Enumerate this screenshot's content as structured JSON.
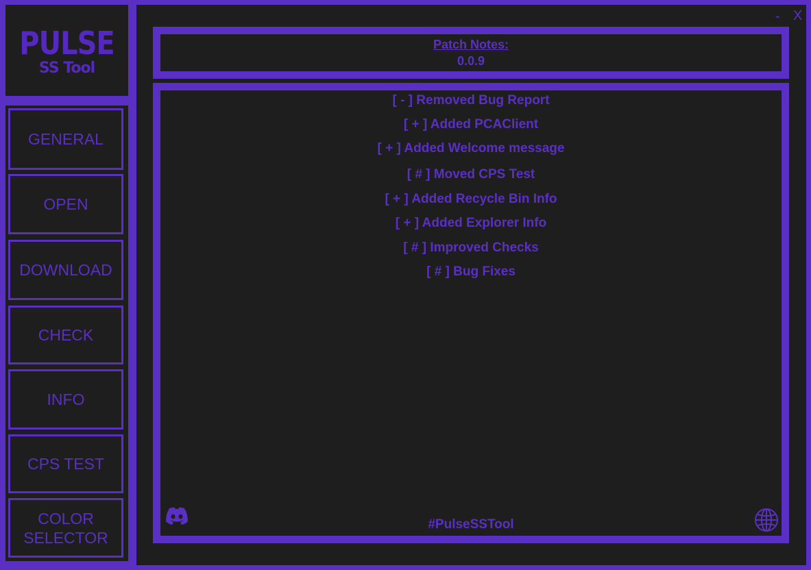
{
  "logo": {
    "title": "PULSE",
    "subtitle": "SS Tool"
  },
  "window_controls": {
    "minimize": "-",
    "close": "X"
  },
  "nav": [
    {
      "label": "GENERAL"
    },
    {
      "label": "OPEN"
    },
    {
      "label": "DOWNLOAD"
    },
    {
      "label": "CHECK"
    },
    {
      "label": "INFO"
    },
    {
      "label": "CPS TEST"
    },
    {
      "label": "COLOR\nSELECTOR"
    }
  ],
  "patch_notes": {
    "title": "Patch Notes:",
    "version": "0.0.9",
    "lines": [
      "[ - ] Removed Bug Report",
      "[ + ] Added PCAClient",
      "[ + ] Added Welcome message",
      "[ # ] Moved CPS Test",
      "[ + ] Added Recycle Bin Info",
      "[ + ] Added Explorer Info",
      "[ # ] Improved Checks",
      "[ # ] Bug Fixes"
    ]
  },
  "footer": {
    "hashtag": "#PulseSSTool",
    "left_icon": "discord-icon",
    "right_icon": "globe-icon"
  },
  "colors": {
    "accent": "#5a2fc4",
    "panel": "#1e1e1e",
    "logo": "#5528c0"
  }
}
